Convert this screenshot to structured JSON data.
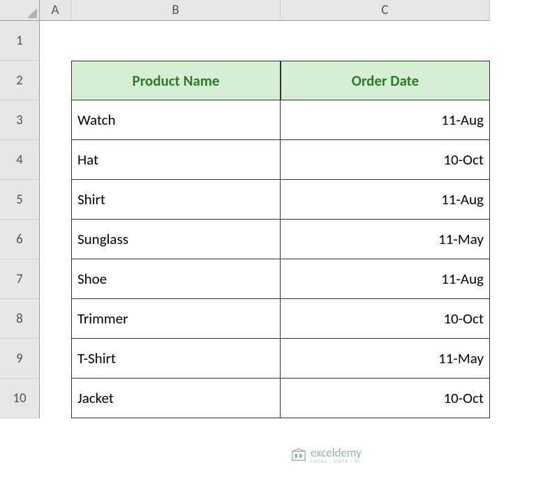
{
  "columns": [
    "A",
    "B",
    "C"
  ],
  "rows": [
    "1",
    "2",
    "3",
    "4",
    "5",
    "6",
    "7",
    "8",
    "9",
    "10"
  ],
  "table": {
    "header_product": "Product Name",
    "header_date": "Order Date",
    "data": [
      {
        "product": "Watch",
        "date": "11-Aug"
      },
      {
        "product": "Hat",
        "date": "10-Oct"
      },
      {
        "product": "Shirt",
        "date": "11-Aug"
      },
      {
        "product": "Sunglass",
        "date": "11-May"
      },
      {
        "product": "Shoe",
        "date": "11-Aug"
      },
      {
        "product": "Trimmer",
        "date": "10-Oct"
      },
      {
        "product": "T-Shirt",
        "date": "11-May"
      },
      {
        "product": "Jacket",
        "date": "10-Oct"
      }
    ]
  },
  "watermark": {
    "brand": "exceldemy",
    "sub": "EXCEL · DATA · BI"
  }
}
